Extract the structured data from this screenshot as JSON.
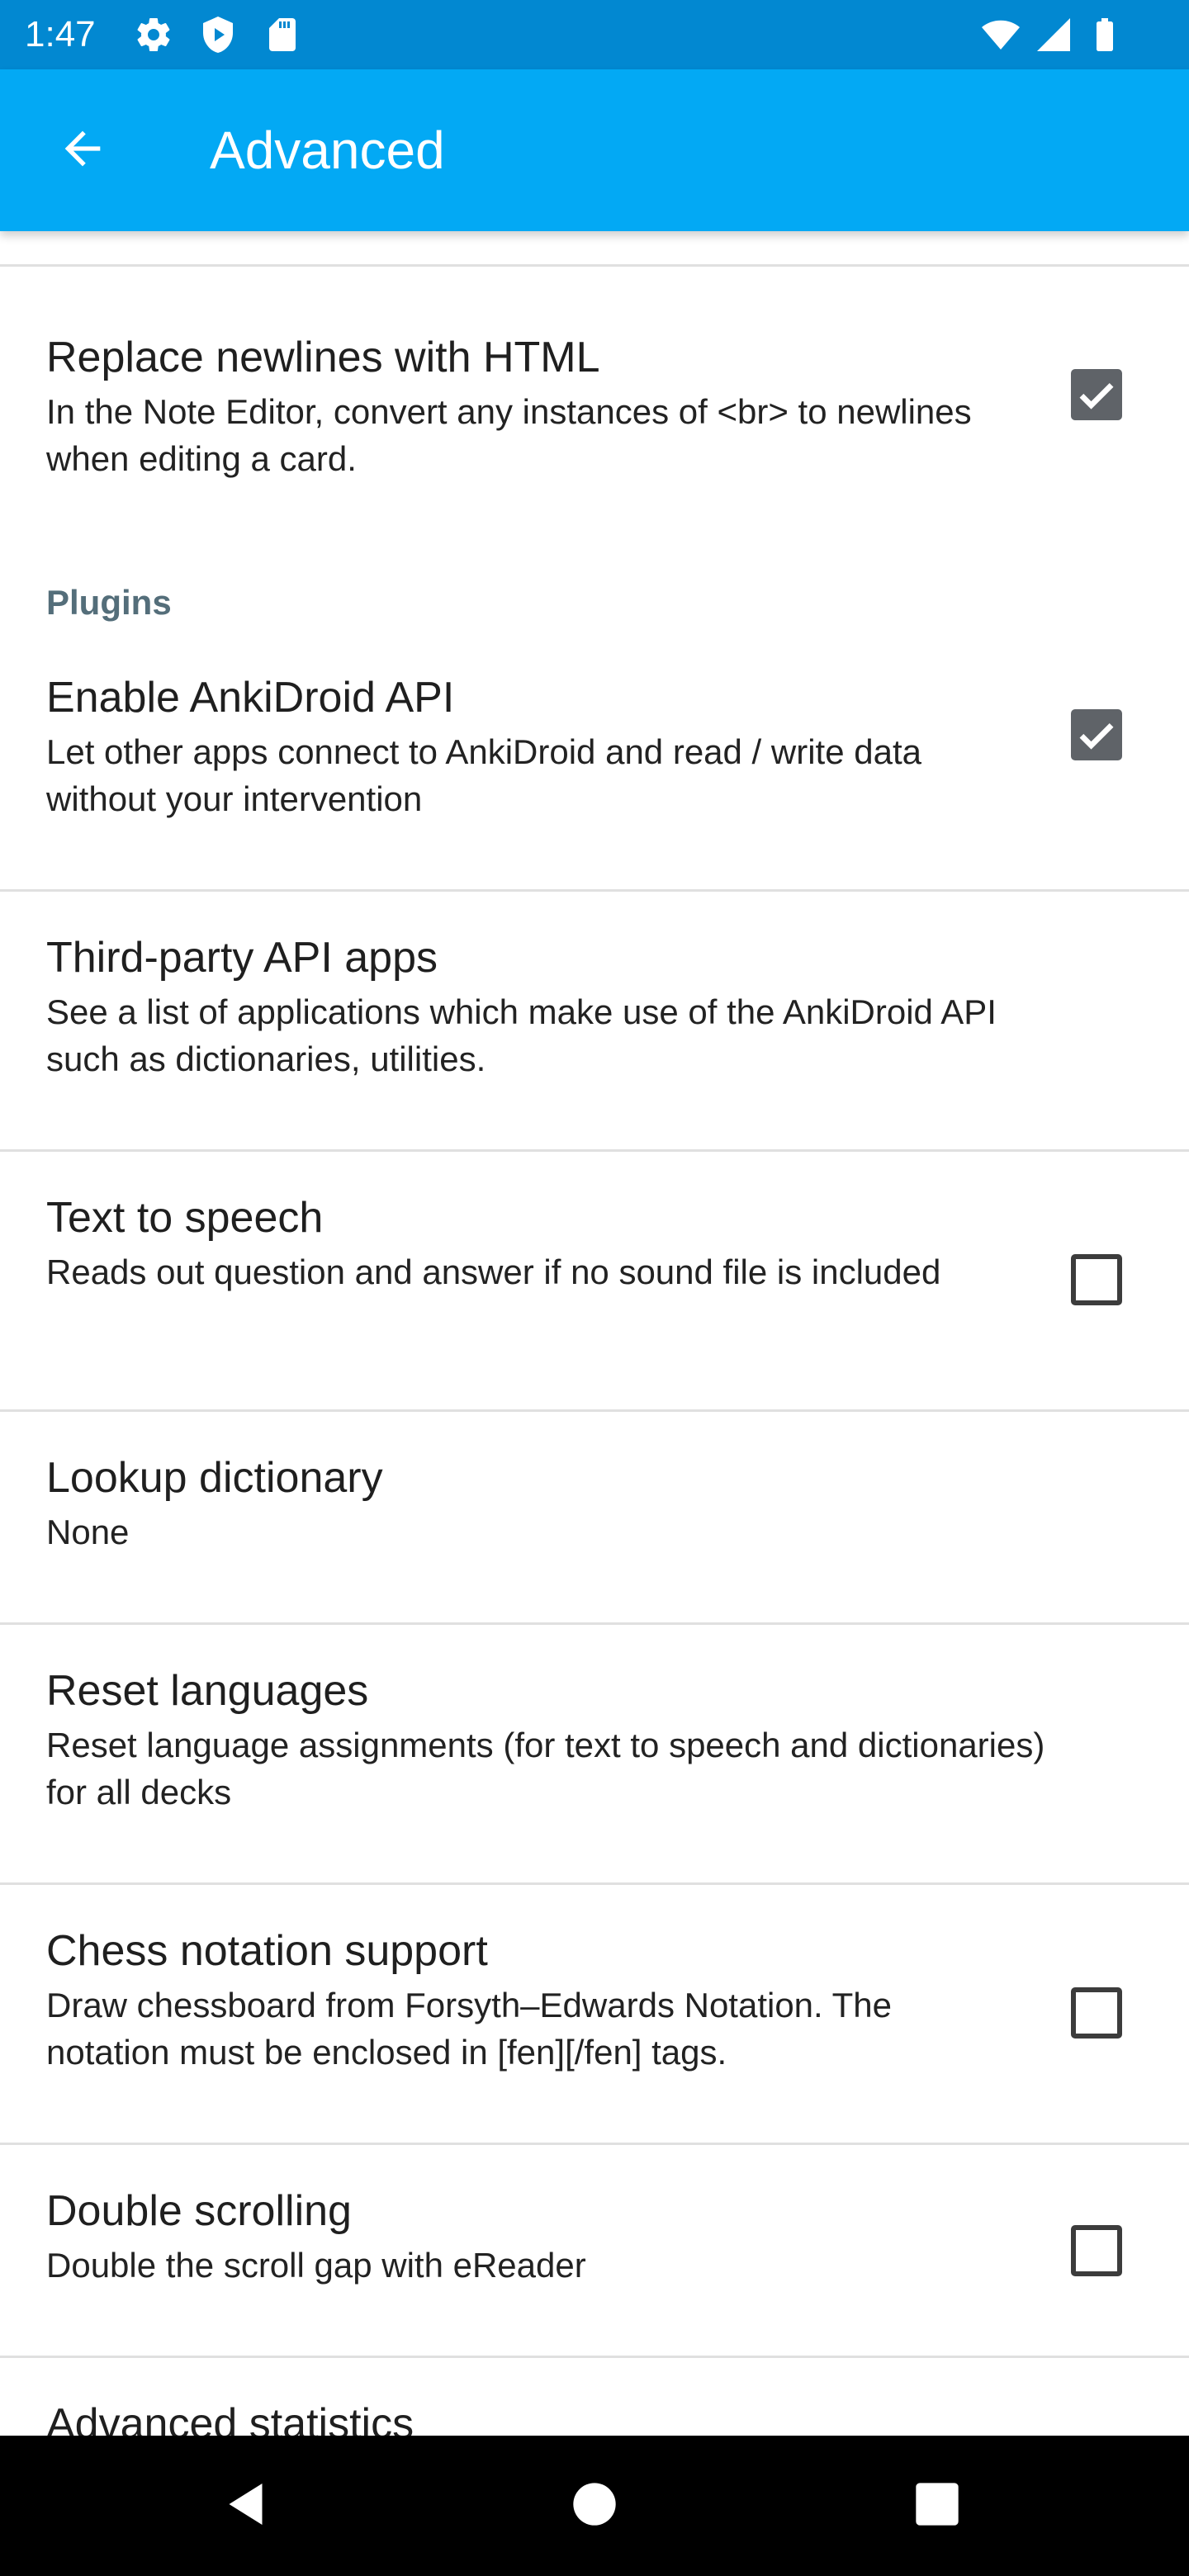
{
  "status_bar": {
    "time": "1:47",
    "icons": [
      "gear-icon",
      "shield-icon",
      "sd-card-icon",
      "wifi-icon",
      "signal-icon",
      "battery-icon"
    ]
  },
  "app_bar": {
    "title": "Advanced",
    "back_icon": "arrow-back-icon"
  },
  "colors": {
    "status_bar": "#0288d1",
    "app_bar": "#03a9f4",
    "category": "#546e7a",
    "checkbox_checked": "#5f6368"
  },
  "preferences": {
    "replace_newlines": {
      "title": "Replace newlines with HTML",
      "summary": "In the Note Editor, convert any instances of <br> to newlines when editing a card.",
      "checked": true
    },
    "plugins_category": "Plugins",
    "enable_api": {
      "title": "Enable AnkiDroid API",
      "summary": "Let other apps connect to AnkiDroid and read / write data without your intervention",
      "checked": true
    },
    "third_party_apps": {
      "title": "Third-party API apps",
      "summary": "See a list of applications which make use of the AnkiDroid API such as dictionaries, utilities."
    },
    "text_to_speech": {
      "title": "Text to speech",
      "summary": "Reads out question and answer if no sound file is included",
      "checked": false
    },
    "lookup_dictionary": {
      "title": "Lookup dictionary",
      "summary": "None"
    },
    "reset_languages": {
      "title": "Reset languages",
      "summary": "Reset language assignments (for text to speech and dictionaries) for all decks"
    },
    "chess_notation": {
      "title": "Chess notation support",
      "summary": "Draw chessboard from Forsyth–Edwards Notation. The notation must be enclosed in [fen][/fen] tags.",
      "checked": false
    },
    "double_scrolling": {
      "title": "Double scrolling",
      "summary": "Double the scroll gap with eReader",
      "checked": false
    },
    "advanced_statistics": {
      "title": "Advanced statistics"
    }
  },
  "nav_bar": {
    "icons": [
      "back-triangle-icon",
      "home-circle-icon",
      "recents-square-icon"
    ]
  }
}
